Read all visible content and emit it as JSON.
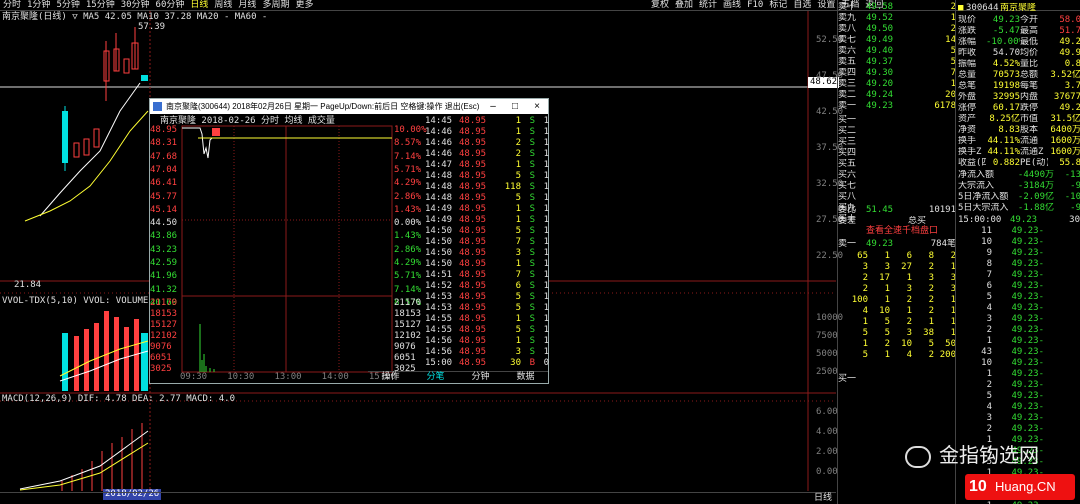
{
  "header": {
    "left_tabs": [
      "分时",
      "1分钟",
      "5分钟",
      "15分钟",
      "30分钟",
      "60分钟",
      "日线",
      "周线",
      "月线",
      "多周期",
      "更多"
    ],
    "active_tab": "日线",
    "tools": [
      "复权",
      "叠加",
      "统计",
      "画线",
      "F10",
      "标记",
      "自选",
      "设置",
      "五档",
      "返回"
    ],
    "stock_code": "300644",
    "stock_name": "南京聚隆"
  },
  "kline": {
    "title": "南京聚隆(日线) ▽ MA5 42.05 MA10 37.28 MA20 - MA60 -",
    "high_label": "57.39",
    "low_label": "21.84",
    "price_tag": "48.62",
    "axis_ticks": [
      "52.50",
      "47.50",
      "42.50",
      "37.50",
      "32.50",
      "27.50",
      "22.50"
    ],
    "vol_title": "VVOL-TDX(5,10) VVOL: VOLUME: 59183.84 MA",
    "vol_ticks": [
      "10000",
      "7500",
      "5000",
      "2500"
    ],
    "macd_title": "MACD(12,26,9) DIF: 4.78 DEA: 2.77 MACD: 4.0",
    "macd_ticks": [
      "6.00",
      "4.00",
      "2.00",
      "0.00"
    ],
    "date_label": "2018/02/26",
    "bottom_label": "日线"
  },
  "window": {
    "title": "南京聚隆(300644) 2018年02月26日 星期一 PageUp/Down:前后日 空格键:操作 退出(Esc)",
    "chart_title": "南京聚隆 2018-02-26 分时 均线 成交量",
    "left_prices": [
      "48.95",
      "48.31",
      "47.68",
      "47.04",
      "46.41",
      "45.77",
      "45.14",
      "44.50",
      "43.86",
      "43.23",
      "42.59",
      "41.96",
      "41.32",
      "40.69"
    ],
    "right_pcts": [
      "10.00%",
      "8.57%",
      "7.14%",
      "5.71%",
      "4.29%",
      "2.86%",
      "1.43%",
      "0.00%",
      "1.43%",
      "2.86%",
      "4.29%",
      "5.71%",
      "7.14%",
      "8.57%"
    ],
    "vol_left": [
      "21170",
      "18153",
      "15127",
      "12102",
      "9076",
      "6051",
      "3025"
    ],
    "vol_right": [
      "21170",
      "18153",
      "15127",
      "12102",
      "9076",
      "6051",
      "3025"
    ],
    "time_axis": [
      "09:30",
      "10:30",
      "13:00",
      "14:00",
      "15:00"
    ],
    "bottom_tabs": [
      "操作",
      "分笔",
      "分钟",
      "数据"
    ],
    "ticks": [
      [
        "14:45",
        "48.95",
        "1",
        "S",
        "1"
      ],
      [
        "14:46",
        "48.95",
        "1",
        "S",
        "1"
      ],
      [
        "14:46",
        "48.95",
        "2",
        "S",
        "1"
      ],
      [
        "14:46",
        "48.95",
        "2",
        "S",
        "1"
      ],
      [
        "14:47",
        "48.95",
        "1",
        "S",
        "1"
      ],
      [
        "14:48",
        "48.95",
        "5",
        "S",
        "1"
      ],
      [
        "14:48",
        "48.95",
        "118",
        "S",
        "1"
      ],
      [
        "14:48",
        "48.95",
        "5",
        "S",
        "1"
      ],
      [
        "14:49",
        "48.95",
        "1",
        "S",
        "1"
      ],
      [
        "14:49",
        "48.95",
        "1",
        "S",
        "1"
      ],
      [
        "14:50",
        "48.95",
        "5",
        "S",
        "1"
      ],
      [
        "14:50",
        "48.95",
        "7",
        "S",
        "1"
      ],
      [
        "14:50",
        "48.95",
        "3",
        "S",
        "1"
      ],
      [
        "14:50",
        "48.95",
        "1",
        "S",
        "1"
      ],
      [
        "14:51",
        "48.95",
        "7",
        "S",
        "1"
      ],
      [
        "14:52",
        "48.95",
        "6",
        "S",
        "1"
      ],
      [
        "14:53",
        "48.95",
        "5",
        "S",
        "1"
      ],
      [
        "14:53",
        "48.95",
        "5",
        "S",
        "1"
      ],
      [
        "14:55",
        "48.95",
        "1",
        "S",
        "1"
      ],
      [
        "14:55",
        "48.95",
        "5",
        "S",
        "1"
      ],
      [
        "14:56",
        "48.95",
        "1",
        "S",
        "1"
      ],
      [
        "14:56",
        "48.95",
        "3",
        "S",
        "1"
      ],
      [
        "15:00",
        "48.95",
        "30",
        "B",
        "0"
      ]
    ]
  },
  "orderbook": {
    "rows": [
      [
        "卖十",
        "49.58",
        "2"
      ],
      [
        "卖九",
        "49.52",
        "1"
      ],
      [
        "卖八",
        "49.50",
        "2"
      ],
      [
        "卖七",
        "49.49",
        "14"
      ],
      [
        "卖六",
        "49.40",
        "5"
      ],
      [
        "卖五",
        "49.37",
        "5"
      ],
      [
        "卖四",
        "49.30",
        "7"
      ],
      [
        "卖三",
        "49.20",
        "1"
      ],
      [
        "卖二",
        "49.24",
        "20"
      ],
      [
        "卖一",
        "49.23",
        "6178"
      ]
    ],
    "buy_labels": [
      "买一",
      "买二",
      "买三",
      "买四",
      "买五",
      "买六",
      "买七",
      "买八",
      "买九",
      "买十"
    ],
    "wb_label": "委比",
    "wb_value": "51.45",
    "wc_label": "委差",
    "wc_value": "10191",
    "buy_total": "总买"
  },
  "quote": {
    "code": "300644",
    "name": "南京聚隆",
    "rows": [
      [
        "现价",
        "49.23",
        "今开",
        "58.0"
      ],
      [
        "涨跌",
        "-5.47",
        "最高",
        "51.7"
      ],
      [
        "涨幅",
        "-10.00%",
        "最低",
        "49.2"
      ],
      [
        "昨收",
        "54.70",
        "均价",
        "49.9"
      ],
      [
        "振幅",
        "4.52%",
        "量比",
        "0.8"
      ],
      [
        "总量",
        "70573",
        "总额",
        "3.52亿"
      ],
      [
        "总笔",
        "19198",
        "每笔",
        "3.7"
      ],
      [
        "外盘",
        "32995",
        "内盘",
        "37677"
      ]
    ],
    "rows2": [
      [
        "涨停",
        "60.17",
        "跌停",
        "49.2"
      ],
      [
        "资产",
        "8.25亿",
        "市值",
        "31.5亿"
      ],
      [
        "净资",
        "8.83",
        "股本",
        "6400万"
      ],
      [
        "换手",
        "44.11%",
        "流通",
        "1600万"
      ],
      [
        "换手Z",
        "44.11%",
        "流通Z",
        "1600万"
      ],
      [
        "收益(四)",
        "0.882",
        "PE(动)",
        "55.8"
      ]
    ],
    "flow": [
      [
        "净流入额",
        "-4490万",
        "-13"
      ],
      [
        "大宗流入",
        "-3184万",
        "-9"
      ],
      [
        "5日净流入额",
        "-2.09亿",
        "-10"
      ],
      [
        "5日大宗流入",
        "-1.88亿",
        "-9"
      ]
    ]
  },
  "queue": {
    "title": "查看全速千档盘口",
    "sell1_label": "卖一",
    "sell1_price": "49.23",
    "sell1_count": "784笔",
    "cells": [
      [
        "65",
        "1",
        "6",
        "8",
        "2"
      ],
      [
        "3",
        "3",
        "27",
        "2",
        "1"
      ],
      [
        "2",
        "17",
        "1",
        "3",
        "3"
      ],
      [
        "2",
        "1",
        "3",
        "2",
        "3"
      ],
      [
        "100",
        "1",
        "2",
        "2",
        "1"
      ],
      [
        "4",
        "10",
        "1",
        "2",
        "1"
      ],
      [
        "1",
        "5",
        "2",
        "1",
        "1"
      ],
      [
        "5",
        "5",
        "3",
        "38",
        "1"
      ],
      [
        "1",
        "2",
        "10",
        "5",
        "50"
      ],
      [
        "5",
        "1",
        "4",
        "2",
        "200"
      ]
    ],
    "buy1_label": "买一"
  },
  "trades": {
    "header_time": "15:00:00",
    "header_price": "49.23",
    "header_vol": "30",
    "rows": [
      [
        "11",
        "49.23-"
      ],
      [
        "10",
        "49.23-"
      ],
      [
        "9",
        "49.23-"
      ],
      [
        "8",
        "49.23-"
      ],
      [
        "7",
        "49.23-"
      ],
      [
        "6",
        "49.23-"
      ],
      [
        "5",
        "49.23-"
      ],
      [
        "4",
        "49.23-"
      ],
      [
        "3",
        "49.23-"
      ],
      [
        "2",
        "49.23-"
      ],
      [
        "1",
        "49.23-"
      ],
      [
        "43",
        "49.23-"
      ],
      [
        "10",
        "49.23-"
      ],
      [
        "1",
        "49.23-"
      ],
      [
        "2",
        "49.23-"
      ],
      [
        "5",
        "49.23-"
      ],
      [
        "4",
        "49.23-"
      ],
      [
        "3",
        "49.23-"
      ],
      [
        "2",
        "49.23-"
      ],
      [
        "1",
        "49.23-"
      ],
      [
        "1",
        "49.23-"
      ],
      [
        "5",
        "49.23-"
      ],
      [
        "1",
        "49.23-"
      ],
      [
        "1",
        "49.23-"
      ],
      [
        "1",
        "49.23-"
      ],
      [
        "1",
        "49.23-"
      ],
      [
        "1",
        "49.23-"
      ]
    ]
  },
  "watermark": {
    "text": "金指钩选网",
    "brand_prefix": "10",
    "brand_text": "Huang.CN"
  },
  "colors": {
    "up": "#ff4040",
    "down": "#33dd33",
    "cyan": "#00e0e0",
    "grid": "#8b1a1a",
    "magenta": "#ff33ff",
    "yellow": "#ffff33"
  }
}
